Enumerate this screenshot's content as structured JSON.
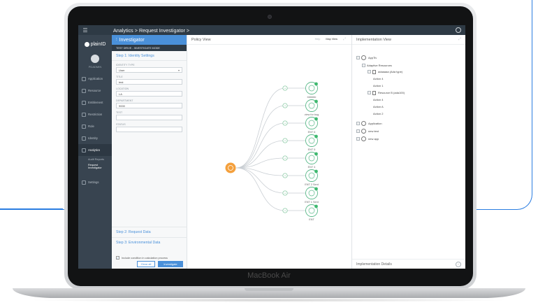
{
  "device": {
    "label": "MacBook Air"
  },
  "topbar": {
    "breadcrumb": "Analytics  >  Request Investigator  >"
  },
  "sidebar": {
    "logo": "plainID",
    "user": "PDADMIN",
    "items": [
      {
        "label": "Application",
        "icon": "app-icon"
      },
      {
        "label": "Resource",
        "icon": "resource-icon"
      },
      {
        "label": "Entitlement",
        "icon": "entitlement-icon"
      },
      {
        "label": "Restriction",
        "icon": "restriction-icon"
      },
      {
        "label": "Role",
        "icon": "role-icon"
      },
      {
        "label": "Identity",
        "icon": "identity-icon"
      },
      {
        "label": "Analytics",
        "icon": "analytics-icon"
      },
      {
        "label": "Settings",
        "icon": "settings-icon"
      }
    ],
    "subitems": [
      "Audit Reports",
      "Request Investigator"
    ]
  },
  "panel": {
    "title": "Investigator",
    "mode": "TEST DRIVE - INVESTIGATE MODE",
    "step1": "Step 1: Identity Settings",
    "fields": [
      {
        "label": "IDENTITY TYPE",
        "value": "User"
      },
      {
        "label": "TITLE",
        "value": "test"
      },
      {
        "label": "LOCATION",
        "value": "LA"
      },
      {
        "label": "DEPARTMENT",
        "value": "9000"
      },
      {
        "label": "TEST",
        "value": ""
      },
      {
        "label": "STATUS",
        "value": ""
      }
    ],
    "step2": "Step 2: Request Data",
    "step3": "Step 3: Environmental Data",
    "checkbox_label": "Include condition in calculation process",
    "clear_label": "Clear all",
    "investigate_label": "Investigate"
  },
  "policy": {
    "title": "Policy View",
    "tab_help": "Help",
    "tab_map": "Map View",
    "nodes": [
      "bbbbbb",
      "view for bug",
      "ENT 6",
      "ENT 5",
      "ENT 4",
      "ENT 2 Sent",
      "ENT 1 Sent",
      "ENT"
    ]
  },
  "impl": {
    "title": "Implementation View",
    "tree": [
      {
        "label": "AppTiv",
        "kind": "globe",
        "indent": 0
      },
      {
        "label": "Adaptive Resources",
        "kind": "none",
        "indent": 1
      },
      {
        "label": "adaaaaa (Ada type)",
        "kind": "doc",
        "indent": 2
      },
      {
        "label": "Action 4",
        "kind": "none",
        "indent": 3
      },
      {
        "label": "Action 1",
        "kind": "none",
        "indent": 3
      },
      {
        "label": "Resource B (ada100)",
        "kind": "doc",
        "indent": 2
      },
      {
        "label": "Action 4",
        "kind": "none",
        "indent": 3
      },
      {
        "label": "Action A",
        "kind": "none",
        "indent": 3
      },
      {
        "label": "Action 2",
        "kind": "none",
        "indent": 3
      },
      {
        "label": "Application",
        "kind": "globe",
        "indent": 0
      },
      {
        "label": "new test",
        "kind": "globe",
        "indent": 0
      },
      {
        "label": "new app",
        "kind": "globe",
        "indent": 0
      }
    ],
    "footer": "Implementation Details"
  }
}
